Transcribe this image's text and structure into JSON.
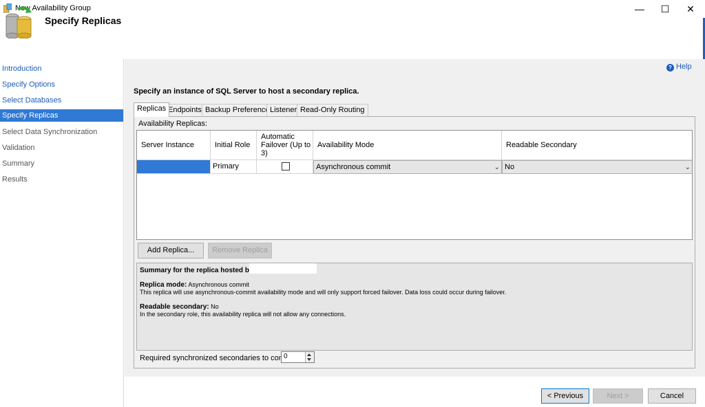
{
  "window": {
    "title": "New Availability Group",
    "minimize": "—",
    "maximize": "☐",
    "close": "✕"
  },
  "header": {
    "title": "Specify Replicas"
  },
  "sidebar": {
    "items": [
      {
        "label": "Introduction",
        "state": "link"
      },
      {
        "label": "Specify Options",
        "state": "link"
      },
      {
        "label": "Select Databases",
        "state": "link"
      },
      {
        "label": "Specify Replicas",
        "state": "active"
      },
      {
        "label": "Select Data Synchronization",
        "state": "dim"
      },
      {
        "label": "Validation",
        "state": "dim"
      },
      {
        "label": "Summary",
        "state": "dim"
      },
      {
        "label": "Results",
        "state": "dim"
      }
    ]
  },
  "help": {
    "label": "Help",
    "icon": "help-circle-icon"
  },
  "instruction": "Specify an instance of SQL Server to host a secondary replica.",
  "tabs": [
    {
      "label": "Replicas",
      "active": true
    },
    {
      "label": "Endpoints",
      "active": false
    },
    {
      "label": "Backup Preferences",
      "active": false
    },
    {
      "label": "Listener",
      "active": false
    },
    {
      "label": "Read-Only Routing",
      "active": false
    }
  ],
  "replicas": {
    "label": "Availability Replicas:",
    "columns": {
      "server_instance": "Server Instance",
      "initial_role": "Initial Role",
      "automatic_failover": "Automatic Failover (Up to 3)",
      "availability_mode": "Availability Mode",
      "readable_secondary": "Readable Secondary"
    },
    "rows": [
      {
        "server_instance": "",
        "initial_role": "Primary",
        "automatic_failover": false,
        "availability_mode": "Asynchronous commit",
        "readable_secondary": "No"
      }
    ]
  },
  "buttons": {
    "add_replica": "Add Replica...",
    "remove_replica": "Remove Replica"
  },
  "summary": {
    "title": "Summary for the replica hosted by",
    "replica_mode_label": "Replica mode:",
    "replica_mode_value": "Asynchronous commit",
    "replica_mode_desc": "This replica will use asynchronous-commit availability mode and will only support forced failover. Data loss could occur during failover.",
    "readable_label": "Readable secondary:",
    "readable_value": "No",
    "readable_desc": "In the secondary role, this availability replica will not allow any connections."
  },
  "required_secondaries": {
    "label": "Required synchronized secondaries to commit",
    "value": "0"
  },
  "footer": {
    "previous": "< Previous",
    "next": "Next >",
    "cancel": "Cancel"
  },
  "colors": {
    "accent": "#3079d4",
    "link": "#1a5bbf",
    "panel": "#f0f0f0"
  }
}
